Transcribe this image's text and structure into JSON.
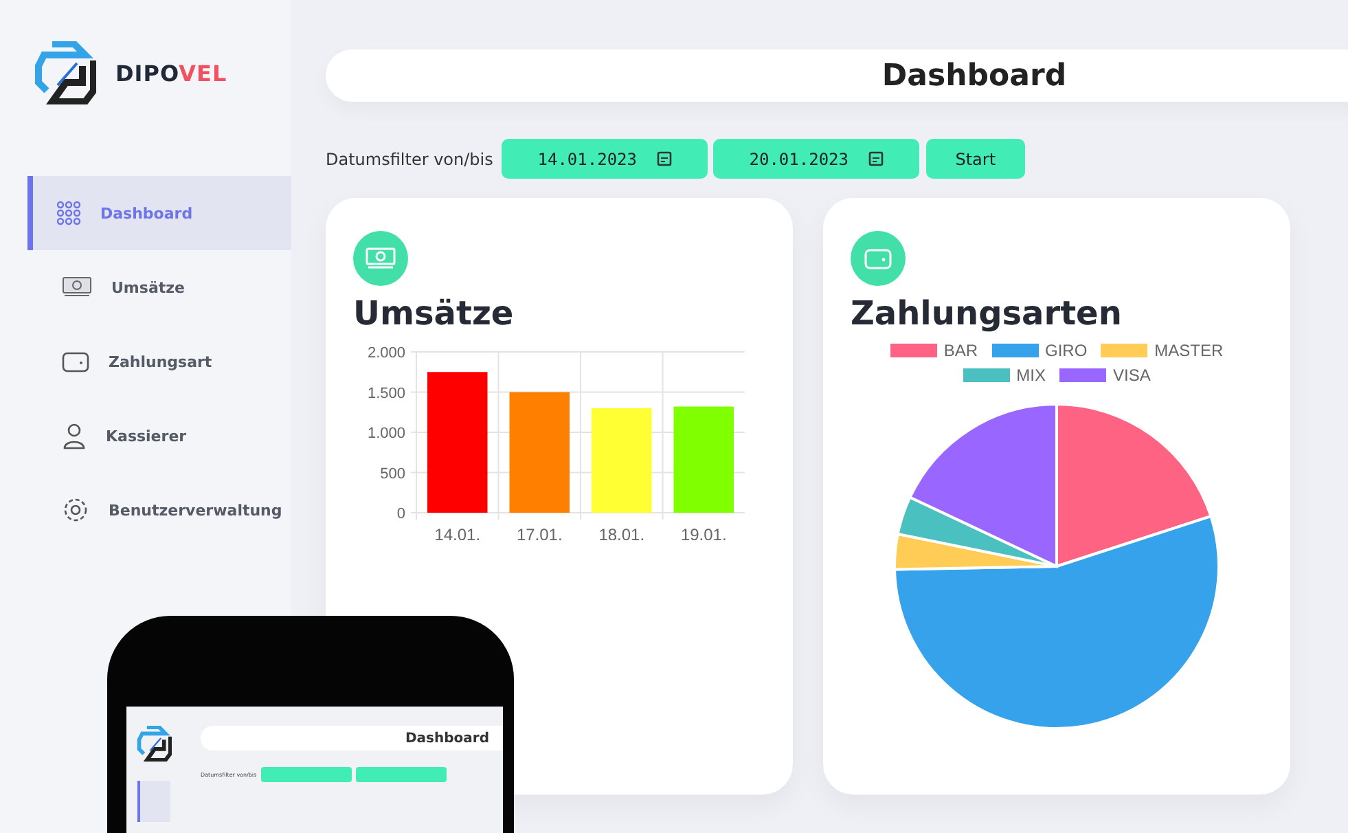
{
  "brand": {
    "name": "DIPO",
    "accent": "VEL"
  },
  "sidebar": {
    "items": [
      {
        "label": "Dashboard",
        "selected": true
      },
      {
        "label": "Umsätze",
        "selected": false
      },
      {
        "label": "Zahlungsart",
        "selected": false
      },
      {
        "label": "Kassierer",
        "selected": false
      },
      {
        "label": "Benutzerverwaltung",
        "selected": false
      }
    ]
  },
  "header": {
    "title": "Dashboard"
  },
  "filter": {
    "label": "Datumsfilter von/bis",
    "from": "14.01.2023",
    "to": "20.01.2023",
    "button": "Start"
  },
  "cards": [
    {
      "title": "Umsätze",
      "chart_data": {
        "type": "bar",
        "categories": [
          "14.01.",
          "17.01.",
          "18.01.",
          "19.01."
        ],
        "values": [
          1750,
          1500,
          1300,
          1320
        ],
        "colors": [
          "#ff0000",
          "#ff8000",
          "#ffff33",
          "#80ff00"
        ],
        "ylim": [
          0,
          2000
        ],
        "grid": true,
        "yticks": [
          {
            "value": 0,
            "label": "0"
          },
          {
            "value": 500,
            "label": "500"
          },
          {
            "value": 1000,
            "label": "1.000"
          },
          {
            "value": 1500,
            "label": "1.500"
          },
          {
            "value": 2000,
            "label": "2.000"
          }
        ]
      }
    },
    {
      "title": "Zahlungsarten",
      "legend": [
        {
          "label": "BAR",
          "color": "#ff6384"
        },
        {
          "label": "GIRO",
          "color": "#36a2eb"
        },
        {
          "label": "MASTER",
          "color": "#ffcd56"
        },
        {
          "label": "MIX",
          "color": "#4bc0c0"
        },
        {
          "label": "VISA",
          "color": "#9966ff"
        }
      ]
    }
  ],
  "phone": {
    "title": "Dashboard",
    "filter_label": "Datumsfilter von/bis"
  }
}
